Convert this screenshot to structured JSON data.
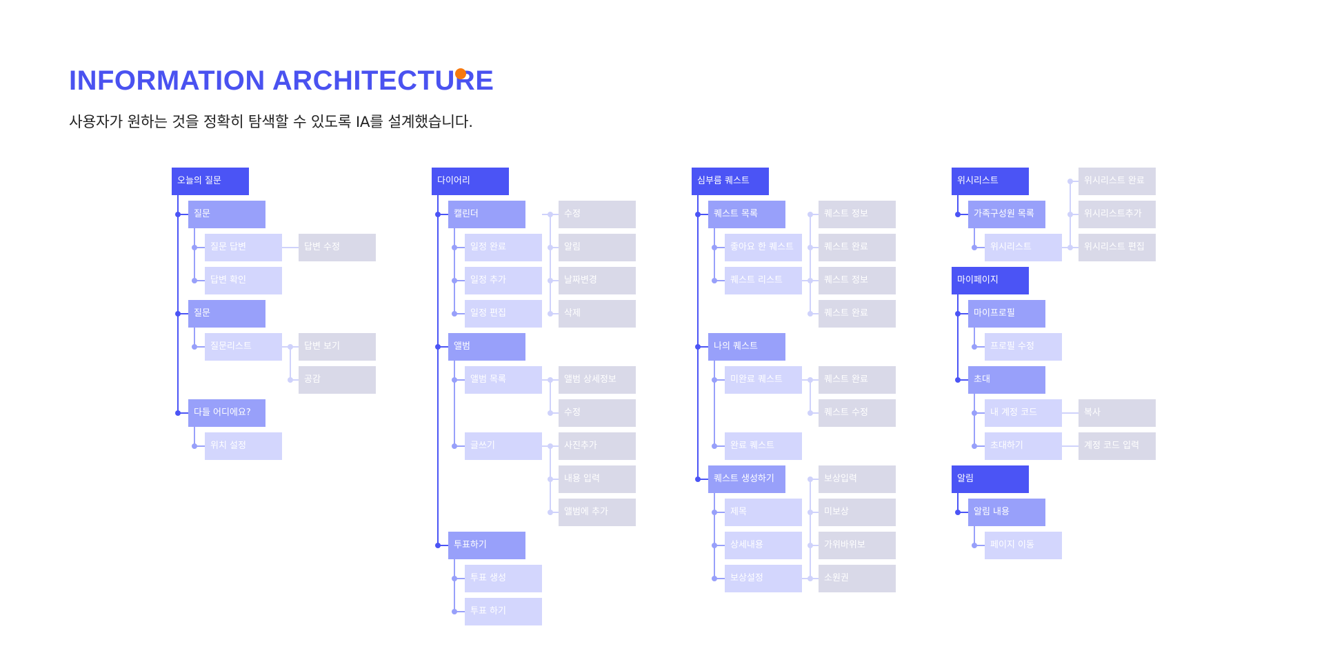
{
  "title": "INFORMATION ARCHITECTURE",
  "subtitle": "사용자가 원하는 것을 정확히 탐색할 수 있도록 IA를 설계했습니다.",
  "colors": {
    "title": "#4a52f0",
    "accent_dot": "#f7790e",
    "level0": "#4b54f5",
    "level1": "#98a0fa",
    "level2": "#d3d6fd",
    "level3": "#d9d9e8",
    "connector_main": "#4b54f5",
    "connector_mid": "#98a0fa",
    "connector_light": "#cfd2fb"
  },
  "sections": [
    {
      "label": "오늘의 질문",
      "children": [
        {
          "label": "질문",
          "children": [
            {
              "label": "질문 답변",
              "children": [
                {
                  "label": "답변 수정"
                }
              ]
            },
            {
              "label": "답변 확인"
            }
          ]
        },
        {
          "label": "질문",
          "children": [
            {
              "label": "질문리스트",
              "children": [
                {
                  "label": "답변 보기"
                },
                {
                  "label": "공감"
                }
              ]
            }
          ]
        },
        {
          "label": "다들 어디에요?",
          "children": [
            {
              "label": "위치 설정"
            }
          ]
        }
      ]
    },
    {
      "label": "다이어리",
      "children": [
        {
          "label": "캘린더",
          "children": [
            {
              "label": "일정 완료"
            },
            {
              "label": "일정 추가"
            },
            {
              "label": "일정 편집"
            }
          ],
          "side": [
            "수정",
            "알림",
            "날짜변경",
            "삭제"
          ]
        },
        {
          "label": "앨범",
          "children": [
            {
              "label": "앨범 목록",
              "children": [
                {
                  "label": "앨범 상세정보"
                },
                {
                  "label": "수정"
                }
              ]
            },
            {
              "label": "글쓰기",
              "children": [
                {
                  "label": "사진추가"
                },
                {
                  "label": "내용 입력"
                },
                {
                  "label": "앨범에 추가"
                }
              ]
            }
          ]
        },
        {
          "label": "투표하기",
          "children": [
            {
              "label": "투표 생성"
            },
            {
              "label": "투표 하기"
            }
          ]
        }
      ]
    },
    {
      "label": "심부름 퀘스트",
      "children": [
        {
          "label": "퀘스트 목록",
          "children": [
            {
              "label": "좋아요 한 퀘스트"
            },
            {
              "label": "퀘스트 리스트"
            }
          ],
          "side": [
            "퀘스트 정보",
            "퀘스트 완료",
            "퀘스트 정보",
            "퀘스트 완료"
          ]
        },
        {
          "label": "나의 퀘스트",
          "children": [
            {
              "label": "미완료 퀘스트",
              "children": [
                {
                  "label": "퀘스트 완료"
                },
                {
                  "label": "퀘스트 수정"
                }
              ]
            },
            {
              "label": "완료 퀘스트"
            }
          ]
        },
        {
          "label": "퀘스트 생성하기",
          "children": [
            {
              "label": "제목"
            },
            {
              "label": "상세내용"
            },
            {
              "label": "보상설정"
            }
          ],
          "side": [
            "보상입력",
            "미보상",
            "가위바위보",
            "소원권"
          ]
        }
      ]
    },
    {
      "label": "위시리스트",
      "children": [
        {
          "label": "가족구성원 목록",
          "children": [
            {
              "label": "위시리스트"
            }
          ]
        }
      ],
      "side": [
        "위시리스트 완료",
        "위시리스트추가",
        "위시리스트 편집"
      ]
    },
    {
      "label": "마이페이지",
      "children": [
        {
          "label": "마이프로필",
          "children": [
            {
              "label": "프로필 수정"
            }
          ]
        },
        {
          "label": "초대",
          "children": [
            {
              "label": "내 계정 코드",
              "children": [
                {
                  "label": "복사"
                }
              ]
            },
            {
              "label": "초대하기",
              "children": [
                {
                  "label": "계정 코드 입력"
                }
              ]
            }
          ]
        }
      ]
    },
    {
      "label": "알림",
      "children": [
        {
          "label": "알림 내용",
          "children": [
            {
              "label": "페이지 이동"
            }
          ]
        }
      ]
    }
  ]
}
